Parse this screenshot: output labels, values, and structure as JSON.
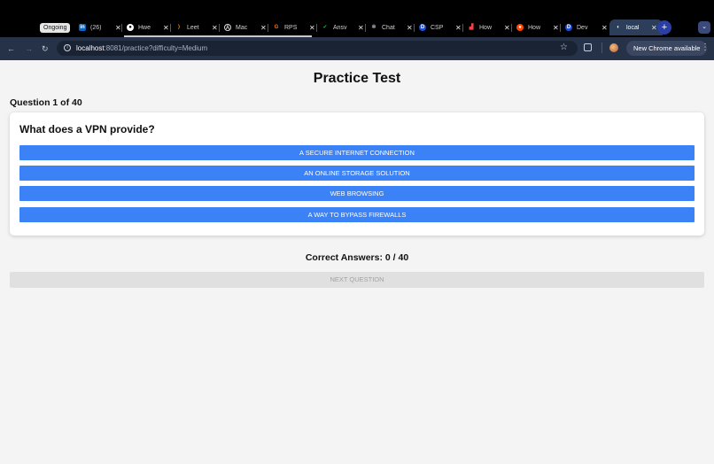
{
  "browser": {
    "ongoing_badge": "Ongoing",
    "tabs": [
      {
        "title": "(26)",
        "icon": "linkedin-icon",
        "color": "#0a66c2",
        "glyph": "in"
      },
      {
        "title": "Hwe",
        "icon": "github-icon",
        "color": "#ffffff",
        "glyph": "●"
      },
      {
        "title": "Leet",
        "icon": "leetcode-icon",
        "color": "#f89f1b",
        "glyph": "⟩"
      },
      {
        "title": "Mac",
        "icon": "a-icon",
        "color": "#ffffff",
        "glyph": "A"
      },
      {
        "title": "RPS",
        "icon": "g-icon",
        "color": "#f97316",
        "glyph": "G"
      },
      {
        "title": "Ansv",
        "icon": "answer-icon",
        "color": "#22c55e",
        "glyph": "✓"
      },
      {
        "title": "Chat",
        "icon": "chatgpt-icon",
        "color": "#9ca3af",
        "glyph": "✻"
      },
      {
        "title": "CSP",
        "icon": "d-icon",
        "color": "#1d4ed8",
        "glyph": "D"
      },
      {
        "title": "How",
        "icon": "chart-icon",
        "color": "#ef4444",
        "glyph": "▟"
      },
      {
        "title": "How",
        "icon": "reddit-icon",
        "color": "#ff4500",
        "glyph": "●"
      },
      {
        "title": "Dev",
        "icon": "d-icon",
        "color": "#1d4ed8",
        "glyph": "D"
      },
      {
        "title": "local",
        "icon": "localhost-icon",
        "color": "#ffffff",
        "glyph": "◐"
      }
    ],
    "url_host": "localhost",
    "url_rest": ":8081/practice?difficulty=Medium",
    "update_label": "New Chrome available"
  },
  "page": {
    "title": "Practice Test",
    "question_counter": "Question 1 of 40",
    "question": "What does a VPN provide?",
    "answers": [
      "A SECURE INTERNET CONNECTION",
      "AN ONLINE STORAGE SOLUTION",
      "WEB BROWSING",
      "A WAY TO BYPASS FIREWALLS"
    ],
    "score": "Correct Answers: 0 / 40",
    "next_label": "NEXT QUESTION"
  },
  "colors": {
    "answer_button": "#3b82f6",
    "next_disabled": "#e0e0e0",
    "page_bg": "#f4f4f5"
  }
}
